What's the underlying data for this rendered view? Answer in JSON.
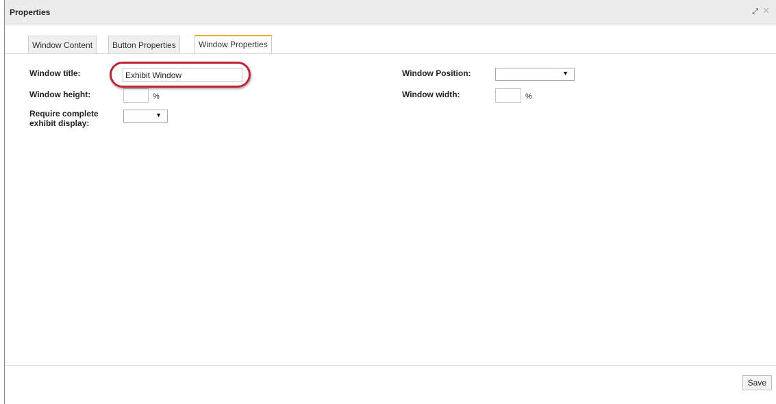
{
  "window": {
    "title": "Properties",
    "expand_icon": "expand-arrows-icon",
    "close_icon": "close-icon"
  },
  "tabs": [
    {
      "label": "Window Content",
      "active": false
    },
    {
      "label": "Button Properties",
      "active": false
    },
    {
      "label": "Window Properties",
      "active": true
    }
  ],
  "form": {
    "window_title": {
      "label": "Window title:",
      "value": "Exhibit Window"
    },
    "window_height": {
      "label": "Window height:",
      "value": "",
      "unit": "%"
    },
    "require_complete": {
      "label_line1": "Require complete",
      "label_line2": "exhibit display:",
      "selected": ""
    },
    "window_position": {
      "label": "Window Position:",
      "selected": ""
    },
    "window_width": {
      "label": "Window width:",
      "value": "",
      "unit": "%"
    }
  },
  "annotation": {
    "highlight_color": "#c4202e"
  },
  "footer": {
    "save_label": "Save"
  },
  "colors": {
    "active_tab_accent": "#f0a830",
    "titlebar_bg": "#ececec"
  }
}
